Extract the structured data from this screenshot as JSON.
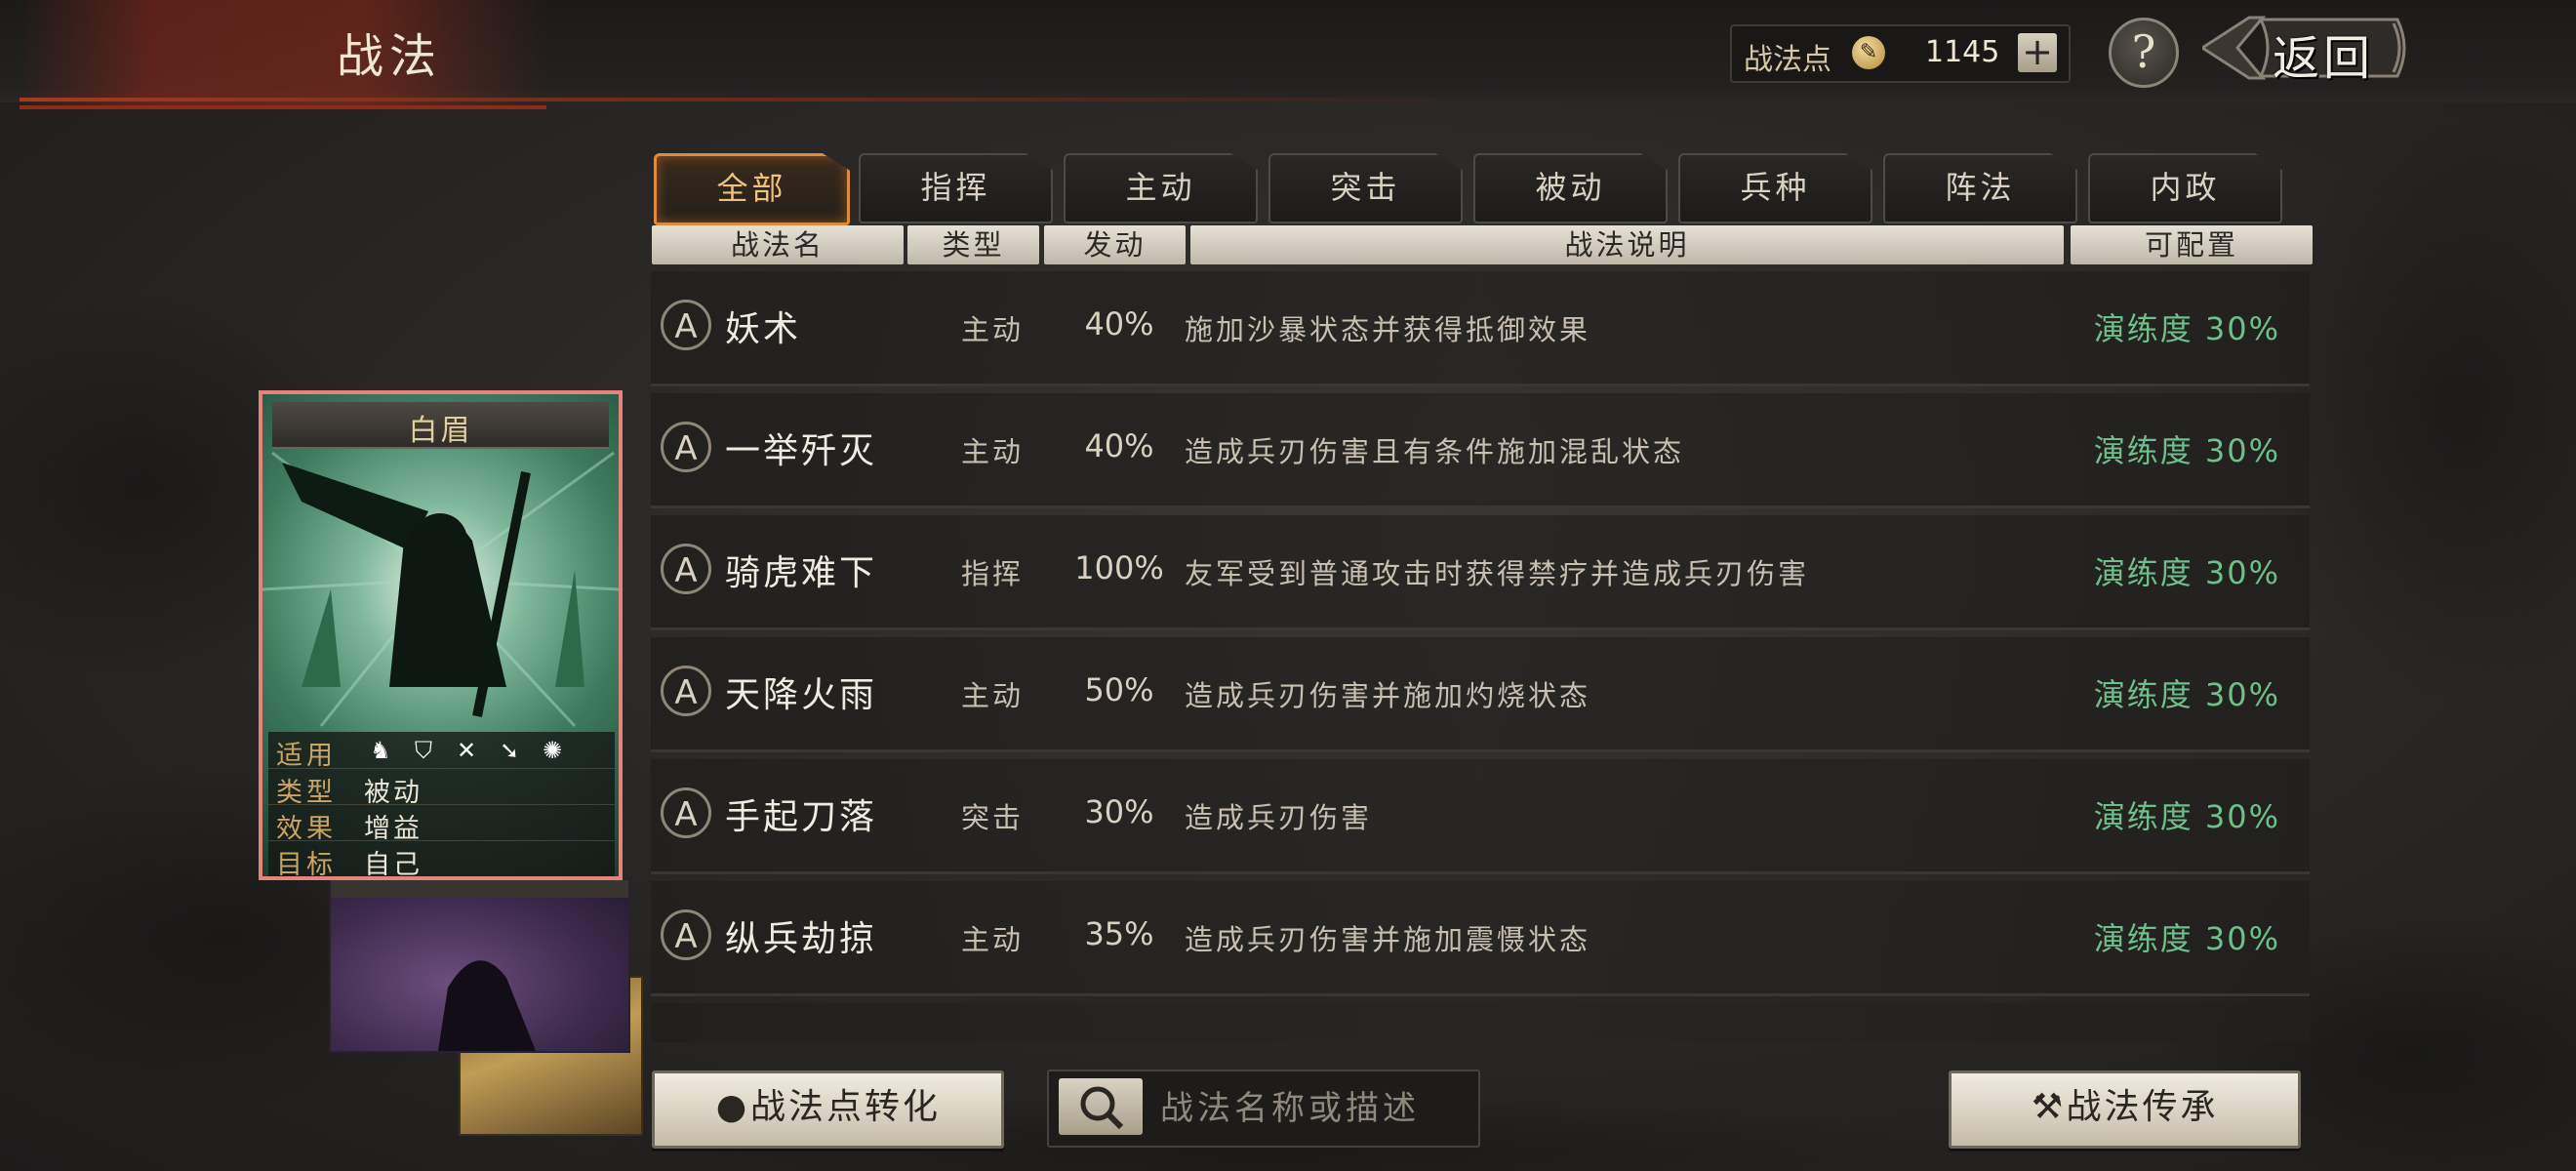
{
  "header": {
    "title": "战法",
    "points_label": "战法点",
    "points_value": "1145",
    "add_label": "+",
    "help_label": "?",
    "back_label": "返回"
  },
  "tabs": [
    {
      "label": "全部",
      "active": true
    },
    {
      "label": "指挥",
      "active": false
    },
    {
      "label": "主动",
      "active": false
    },
    {
      "label": "突击",
      "active": false
    },
    {
      "label": "被动",
      "active": false
    },
    {
      "label": "兵种",
      "active": false
    },
    {
      "label": "阵法",
      "active": false
    },
    {
      "label": "内政",
      "active": false
    }
  ],
  "columns": {
    "name": "战法名",
    "type": "类型",
    "rate": "发动",
    "desc": "战法说明",
    "config": "可配置"
  },
  "skills": [
    {
      "grade": "A",
      "name": "妖术",
      "type": "主动",
      "rate": "40%",
      "desc": "施加沙暴状态并获得抵御效果",
      "config": "演练度 30%"
    },
    {
      "grade": "A",
      "name": "一举歼灭",
      "type": "主动",
      "rate": "40%",
      "desc": "造成兵刃伤害且有条件施加混乱状态",
      "config": "演练度 30%"
    },
    {
      "grade": "A",
      "name": "骑虎难下",
      "type": "指挥",
      "rate": "100%",
      "desc": "友军受到普通攻击时获得禁疗并造成兵刃伤害",
      "config": "演练度 30%"
    },
    {
      "grade": "A",
      "name": "天降火雨",
      "type": "主动",
      "rate": "50%",
      "desc": "造成兵刃伤害并施加灼烧状态",
      "config": "演练度 30%"
    },
    {
      "grade": "A",
      "name": "手起刀落",
      "type": "突击",
      "rate": "30%",
      "desc": "造成兵刃伤害",
      "config": "演练度 30%"
    },
    {
      "grade": "A",
      "name": "纵兵劫掠",
      "type": "主动",
      "rate": "35%",
      "desc": "造成兵刃伤害并施加震慑状态",
      "config": "演练度 30%"
    }
  ],
  "card": {
    "title": "白眉",
    "rows": [
      {
        "key": "适用",
        "value": ""
      },
      {
        "key": "类型",
        "value": "被动"
      },
      {
        "key": "效果",
        "value": "增益"
      },
      {
        "key": "目标",
        "value": "自己"
      }
    ],
    "troop_icons": [
      "cavalry-icon",
      "shield-icon",
      "bow-icon",
      "spear-icon",
      "wheel-icon"
    ]
  },
  "bottom": {
    "convert_label": "战法点转化",
    "search_placeholder": "战法名称或描述",
    "inherit_label": "战法传承"
  },
  "colors": {
    "accent_orange": "#e08a3c",
    "config_green": "#6fbf8a",
    "header_red": "#8e2a18"
  }
}
